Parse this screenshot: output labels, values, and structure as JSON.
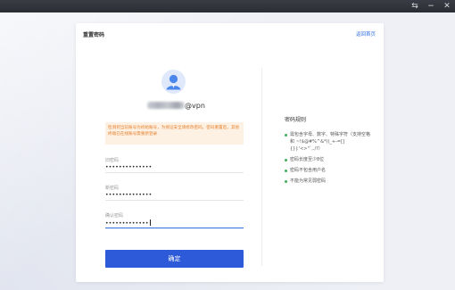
{
  "window": {
    "controls": [
      "⇆",
      "−",
      "✕"
    ]
  },
  "card": {
    "title": "重置密码",
    "back_link": "返回首页"
  },
  "user": {
    "suffix": "@vpn"
  },
  "warning": "检测到当前账号为初始账号，为保证安全请修改密码。密码重置后，其他终端已在线账号需重新登录",
  "form": {
    "old_password": {
      "label": "旧密码",
      "value": "••••••••••••••"
    },
    "new_password": {
      "label": "新密码",
      "value": "••••••••••••••"
    },
    "confirm_password": {
      "label": "确认密码",
      "value": "•••••••••••••"
    }
  },
  "confirm_button": "确定",
  "rules": {
    "title": "密码规则",
    "items": [
      "需包含字母、数字、特殊字符（支持空格和 ~!$@#%^&*()_+-=[]{}|:'<>\"`,./?）",
      "密码长度至少8位",
      "密码不包含用户名",
      "不能为常见弱密码"
    ],
    "bullet_color": "#3fae5a"
  },
  "colors": {
    "accent": "#2d5ad8",
    "link": "#2f6fe0",
    "warning_text": "#e8822d",
    "warning_bg": "#fdf1e4"
  }
}
